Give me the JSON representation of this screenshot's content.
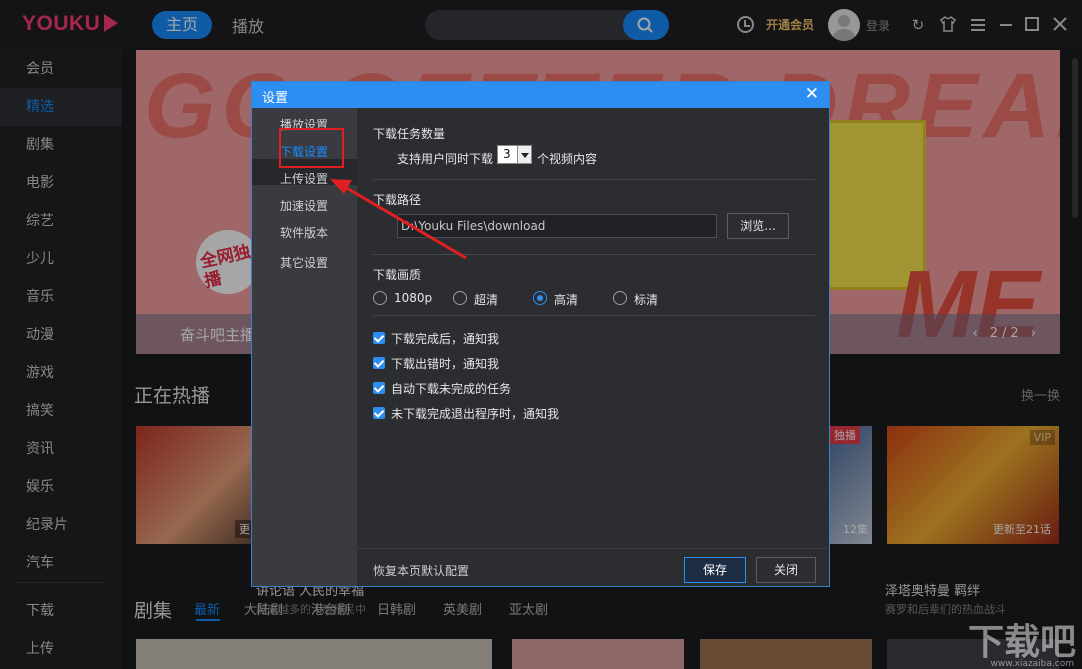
{
  "app": {
    "logo": "YOUKU",
    "nav_home": "主页",
    "nav_play": "播放",
    "vip_open": "开通会员",
    "login": "登录"
  },
  "sidebar": {
    "items": [
      {
        "label": "会员"
      },
      {
        "label": "精选",
        "active": true
      },
      {
        "label": "剧集"
      },
      {
        "label": "电影"
      },
      {
        "label": "综艺"
      },
      {
        "label": "少儿"
      },
      {
        "label": "音乐"
      },
      {
        "label": "动漫"
      },
      {
        "label": "游戏"
      },
      {
        "label": "搞笑"
      },
      {
        "label": "资讯"
      },
      {
        "label": "娱乐"
      },
      {
        "label": "纪录片"
      },
      {
        "label": "汽车"
      },
      {
        "label": "下载"
      },
      {
        "label": "上传"
      }
    ]
  },
  "banner": {
    "big_text": "GO GETTER DREAMERS",
    "big_text2": "ME",
    "tag": "全网独播",
    "title": "奋斗吧主播",
    "pager": "2/2"
  },
  "hot": {
    "title": "正在热播",
    "more": "换一换",
    "cards": [
      {
        "title": "讲论语 人民的幸福",
        "sub": "越来越多的人想移民中",
        "badge": "更"
      },
      {
        "title": "",
        "sub": "",
        "badge": "独播",
        "badge2": "12集"
      },
      {
        "title": "泽塔奥特曼 羁绊",
        "sub": "赛罗和后辈们的热血战斗",
        "badge": "VIP",
        "badge2": "更新至21话"
      }
    ]
  },
  "series": {
    "title": "剧集",
    "tabs": [
      "最新",
      "大陆剧",
      "港台剧",
      "日韩剧",
      "英美剧",
      "亚太剧"
    ]
  },
  "dialog": {
    "title": "设置",
    "nav": [
      {
        "label": "播放设置"
      },
      {
        "label": "下载设置",
        "active": true
      },
      {
        "label": "上传设置"
      },
      {
        "label": "加速设置"
      },
      {
        "label": "软件版本"
      },
      {
        "label": "其它设置"
      }
    ],
    "task_count": {
      "label": "下载任务数量",
      "prefix": "支持用户同时下载",
      "value": "3",
      "suffix": "个视频内容"
    },
    "path": {
      "label": "下载路径",
      "value": "D:\\Youku Files\\download",
      "browse": "浏览..."
    },
    "quality": {
      "label": "下载画质",
      "options": [
        {
          "label": "1080p",
          "selected": false
        },
        {
          "label": "超清",
          "selected": false
        },
        {
          "label": "高清",
          "selected": true
        },
        {
          "label": "标清",
          "selected": false
        }
      ]
    },
    "checks": [
      {
        "label": "下载完成后，通知我",
        "checked": true
      },
      {
        "label": "下载出错时，通知我",
        "checked": true
      },
      {
        "label": "自动下载未完成的任务",
        "checked": true
      },
      {
        "label": "未下载完成退出程序时，通知我",
        "checked": true
      }
    ],
    "footer": {
      "restore": "恢复本页默认配置",
      "save": "保存",
      "close": "关闭"
    }
  },
  "watermark": {
    "text": "下载吧",
    "sub": "www.xiazaiba.com"
  },
  "colors": {
    "accent": "#1a8cff",
    "brand": "#ff3d74",
    "dialog_header": "#2b8ef0",
    "highlight": "#e02020"
  }
}
